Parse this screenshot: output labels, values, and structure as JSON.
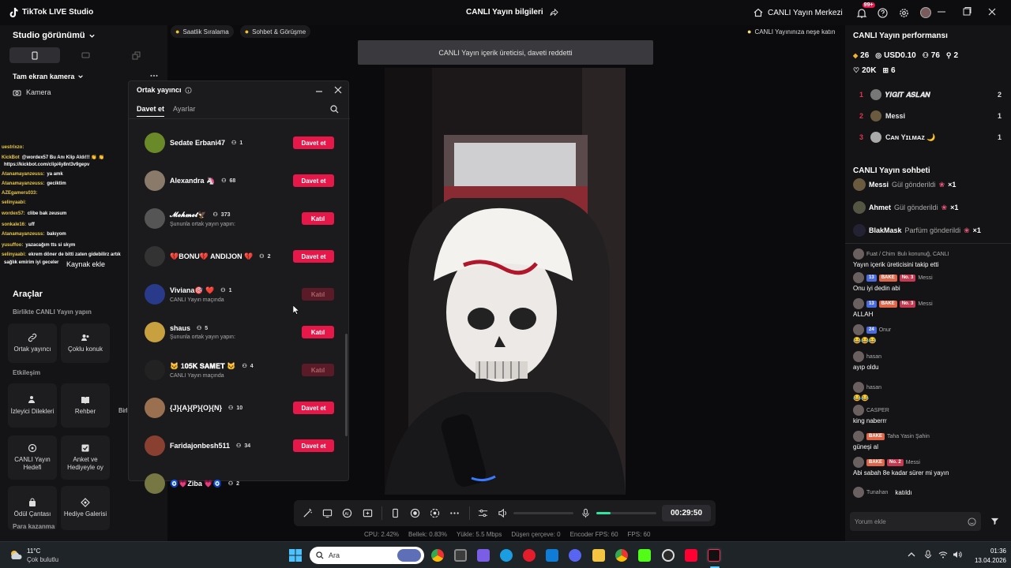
{
  "window": {
    "app_title": "TikTok LIVE Studio",
    "center_title": "CANLI Yayın bilgileri",
    "live_center": "CANLI Yayın Merkezi",
    "notif_count": "99+"
  },
  "left": {
    "studio_view": "Studio görünümü",
    "fullscreen_camera": "Tam ekran kamera",
    "camera": "Kamera",
    "add_source": "Kaynak ekle",
    "tools_title": "Araçlar",
    "together_title": "Birlikte CANLI Yayın yapın",
    "cohost_tool": "Ortak yayıncı",
    "multi_guest": "Çoklu konuk",
    "interaction": "Etkileşim",
    "viewer_requests": "İzleyici Dilekleri",
    "guide": "Rehber",
    "guide_partial": "Birl",
    "live_goal": "CANLI Yayın Hedefi",
    "poll": "Anket ve Hediyeyle oy",
    "reward_bag": "Ödül Çantası",
    "gift_gallery": "Hediye Galerisi",
    "earning": "Para kazanma"
  },
  "chat_overlay": [
    {
      "user": "uestrixzo:",
      "text": ""
    },
    {
      "user": "KickBot",
      "text": "@wordex57 Bu Anı Klip Aldı!!! 👏 👏"
    },
    {
      "user": "",
      "text": "https://kickbot.com/clip/4y8nt3v9gepv"
    },
    {
      "user": "Atanamayanzeuss:",
      "text": "ya amk"
    },
    {
      "user": "Atanamayanzeuss:",
      "text": "geciktim"
    },
    {
      "user": "AZEgamers033:",
      "text": ""
    },
    {
      "user": "selinyaabi:",
      "text": ""
    },
    {
      "user": "wordex57:",
      "text": "clibe bak zeusum"
    },
    {
      "user": "sonkale16:",
      "text": "uff"
    },
    {
      "user": "Atanamayanzeuss:",
      "text": "bakıyom"
    },
    {
      "user": "yusuffoo:",
      "text": "yazacağım tts si skym"
    },
    {
      "user": "selinyaabi:",
      "text": "ekrem döner de bitti zaten gidebilirz artık"
    },
    {
      "user": "",
      "text": "sağlık emirim iyi geceler"
    }
  ],
  "chips": {
    "hourly_ranking": "Saatlik Sıralama",
    "chat_meet": "Sohbet & Görüşme",
    "joy": "CANLI Yayınınıza neşe katın"
  },
  "notice": "CANLI Yayın içerik üreticisi, daveti reddetti",
  "cohost_panel": {
    "title": "Ortak yayıncı",
    "tab_invite": "Davet et",
    "tab_settings": "Ayarlar",
    "rows": [
      {
        "name": "Sedate Erbani47",
        "count": "1",
        "sub": "",
        "action": "Davet et",
        "state": "invite",
        "color": "#6a8a2a"
      },
      {
        "name": "Alexandra 🦄",
        "count": "68",
        "sub": "",
        "action": "Davet et",
        "state": "invite",
        "color": "#8a7a6a"
      },
      {
        "name": "𝓜𝓮𝓱𝓶𝓮𝓽🦅",
        "count": "373",
        "sub": "Şununla ortak yayın yapın:",
        "action": "Katıl",
        "state": "join",
        "color": "#555"
      },
      {
        "name": "💔BONU💔 ANDIJON 💔",
        "count": "2",
        "sub": "",
        "action": "Davet et",
        "state": "invite",
        "color": "#333"
      },
      {
        "name": "Viviana🎯 ❤️",
        "count": "1",
        "sub": "CANLI Yayın maçında",
        "action": "Katıl",
        "state": "disabled",
        "color": "#2a3a8a"
      },
      {
        "name": "shaus",
        "count": "5",
        "sub": "Şununla ortak yayın yapın:",
        "action": "Katıl",
        "state": "join",
        "color": "#c9a040"
      },
      {
        "name": "🐱 1𝟎𝟓𝐊 𝐒𝐀𝐌𝐄𝐓 🐱",
        "count": "4",
        "sub": "CANLI Yayın maçında",
        "action": "Katıl",
        "state": "disabled",
        "color": "#222"
      },
      {
        "name": "{J}{A}{P}{O}{N}",
        "count": "10",
        "sub": "",
        "action": "Davet et",
        "state": "invite",
        "color": "#9a7050"
      },
      {
        "name": "Faridajonbesh511",
        "count": "34",
        "sub": "",
        "action": "Davet et",
        "state": "invite",
        "color": "#8a4030"
      },
      {
        "name": "🧿💗Ziba 💗🧿",
        "count": "2",
        "sub": "",
        "action": "",
        "state": "invite",
        "color": "#774"
      }
    ]
  },
  "controls": {
    "timer": "00:29:50"
  },
  "stats": {
    "cpu": "CPU: 2.42%",
    "memory": "Bellek: 0.83%",
    "upload": "Yükle: 5.5 Mbps",
    "frame_drop": "Düşen çerçeve: 0",
    "encoder_fps": "Encoder FPS: 60",
    "fps": "FPS: 60"
  },
  "right": {
    "perf_title": "CANLI Yayın performansı",
    "diamonds": "26",
    "usd": "USD0.10",
    "viewers": "76",
    "shares": "2",
    "likes": "20K",
    "gifts": "6",
    "ranking": [
      {
        "rank": "1",
        "name": "𝒀𝑰𝑮𝑰𝑻 𝑨𝑺𝑳𝑨𝑵",
        "score": "2",
        "color": "#777"
      },
      {
        "rank": "2",
        "name": "Messi",
        "score": "1",
        "color": "#6a5a40"
      },
      {
        "rank": "3",
        "name": "Cᴀɴ Yɪʟᴍᴀᴢ 🌙",
        "score": "1",
        "color": "#aaa"
      }
    ],
    "chat_title": "CANLI Yayın sohbeti",
    "gifts_list": [
      {
        "name": "Messi",
        "text": "Gül gönderildi",
        "times": "×1",
        "color": "#6a5a40"
      },
      {
        "name": "Ahmet",
        "text": "Gül gönderildi",
        "times": "×1",
        "color": "#554"
      },
      {
        "name": "BlakMask",
        "text": "Parfüm gönderildi",
        "times": "×1",
        "color": "#223"
      }
    ],
    "chat": [
      {
        "name": "Fuat / Chim",
        "text": "Yayın içerik üreticisini takip etti",
        "extra": "Bulı konunuğ, CANLI"
      },
      {
        "name": "Messi",
        "badges": [
          "13",
          "BAKE",
          "No. 3"
        ],
        "text": "Onu iyi dedin abi"
      },
      {
        "name": "Messi",
        "badges": [
          "13",
          "BAKE",
          "No. 3"
        ],
        "text": "ALLAH"
      },
      {
        "name": "Onur",
        "badges": [
          "24"
        ],
        "text": "😂😂😂"
      },
      {
        "name": "hasan",
        "text": "ayıp oldu"
      },
      {
        "name": "hasan",
        "text": "😂😂"
      },
      {
        "name": "CASPER",
        "text": "king naberrr"
      },
      {
        "name": "Taha Yasin Şahin",
        "badges": [
          "BAKE"
        ],
        "text": "güneşi al"
      },
      {
        "name": "Messi",
        "badges": [
          "BAKE",
          "No. 2"
        ],
        "text": "Abi sabah 8e kadar sürer mi yayın"
      },
      {
        "name": "Tunahan",
        "text": "katıldı"
      }
    ],
    "comment_placeholder": "Yorum ekle"
  },
  "taskbar": {
    "temp": "11°C",
    "weather": "Çok bulutlu",
    "search": "Ara",
    "time": "01:36",
    "date": "13.04.2026"
  }
}
